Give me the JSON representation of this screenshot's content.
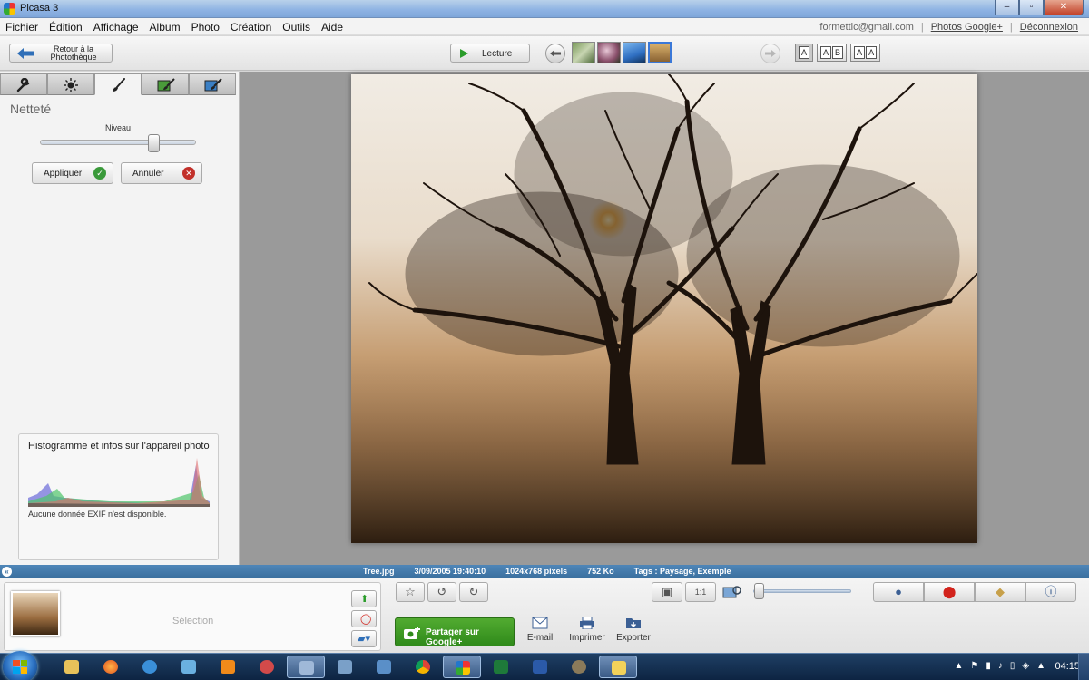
{
  "window": {
    "title": "Picasa 3",
    "minimize": "–",
    "maximize": "▫",
    "close": "✕"
  },
  "menu": [
    "Fichier",
    "Édition",
    "Affichage",
    "Album",
    "Photo",
    "Création",
    "Outils",
    "Aide"
  ],
  "account": {
    "email": "formettic@gmail.com",
    "photos_link": "Photos Google+",
    "logout": "Déconnexion",
    "sep": "|"
  },
  "toolbar": {
    "back_label": "Retour à la Photothèque",
    "play_label": "Lecture",
    "view_single": "A",
    "view_compare_a": "A",
    "view_compare_b": "B",
    "view_dual_a": "A",
    "view_dual_b": "A"
  },
  "edit_panel": {
    "title": "Netteté",
    "slider_label": "Niveau",
    "slider_level": 0.75,
    "apply_label": "Appliquer",
    "cancel_label": "Annuler",
    "apply_icon": "✓",
    "cancel_icon": "✕"
  },
  "histogram": {
    "title": "Histogramme et infos sur l'appareil photo",
    "no_exif": "Aucune donnée EXIF n'est disponible."
  },
  "info_strip": {
    "filename": "Tree.jpg",
    "date": "3/09/2005 19:40:10",
    "dimensions": "1024x768 pixels",
    "size": "752 Ko",
    "tags": "Tags : Paysage, Exemple",
    "expand": "«"
  },
  "tray": {
    "selection_label": "Sélection",
    "share_label": "Partager sur Google+",
    "email_label": "E-mail",
    "print_label": "Imprimer",
    "export_label": "Exporter",
    "zoom_level": 0.05,
    "fit_label": "1:1"
  },
  "taskbar": {
    "clock": "04:15",
    "lang": "▲"
  },
  "colors": {
    "accent": "#3a6f9e",
    "share_green": "#2f8a1a",
    "apply_green": "#3a9a3a",
    "cancel_red": "#c2302a"
  }
}
